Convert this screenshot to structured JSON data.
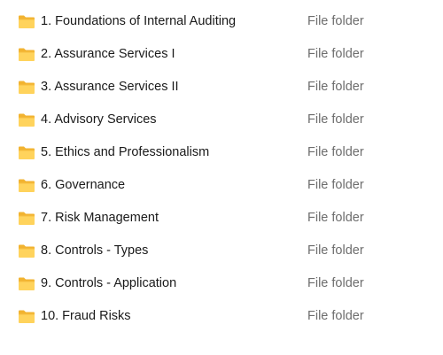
{
  "colors": {
    "folder_front": "#ffd35c",
    "folder_back": "#f2b330",
    "name_text": "#1a1a1a",
    "type_text": "#6d6d6d"
  },
  "files": [
    {
      "name": "1. Foundations of Internal Auditing",
      "type": "File folder",
      "icon": "folder-icon"
    },
    {
      "name": "2. Assurance Services I",
      "type": "File folder",
      "icon": "folder-icon"
    },
    {
      "name": "3. Assurance Services II",
      "type": "File folder",
      "icon": "folder-icon"
    },
    {
      "name": "4. Advisory Services",
      "type": "File folder",
      "icon": "folder-icon"
    },
    {
      "name": "5. Ethics and Professionalism",
      "type": "File folder",
      "icon": "folder-icon"
    },
    {
      "name": "6. Governance",
      "type": "File folder",
      "icon": "folder-icon"
    },
    {
      "name": "7. Risk Management",
      "type": "File folder",
      "icon": "folder-icon"
    },
    {
      "name": "8. Controls - Types",
      "type": "File folder",
      "icon": "folder-icon"
    },
    {
      "name": "9. Controls - Application",
      "type": "File folder",
      "icon": "folder-icon"
    },
    {
      "name": "10. Fraud Risks",
      "type": "File folder",
      "icon": "folder-icon"
    }
  ]
}
